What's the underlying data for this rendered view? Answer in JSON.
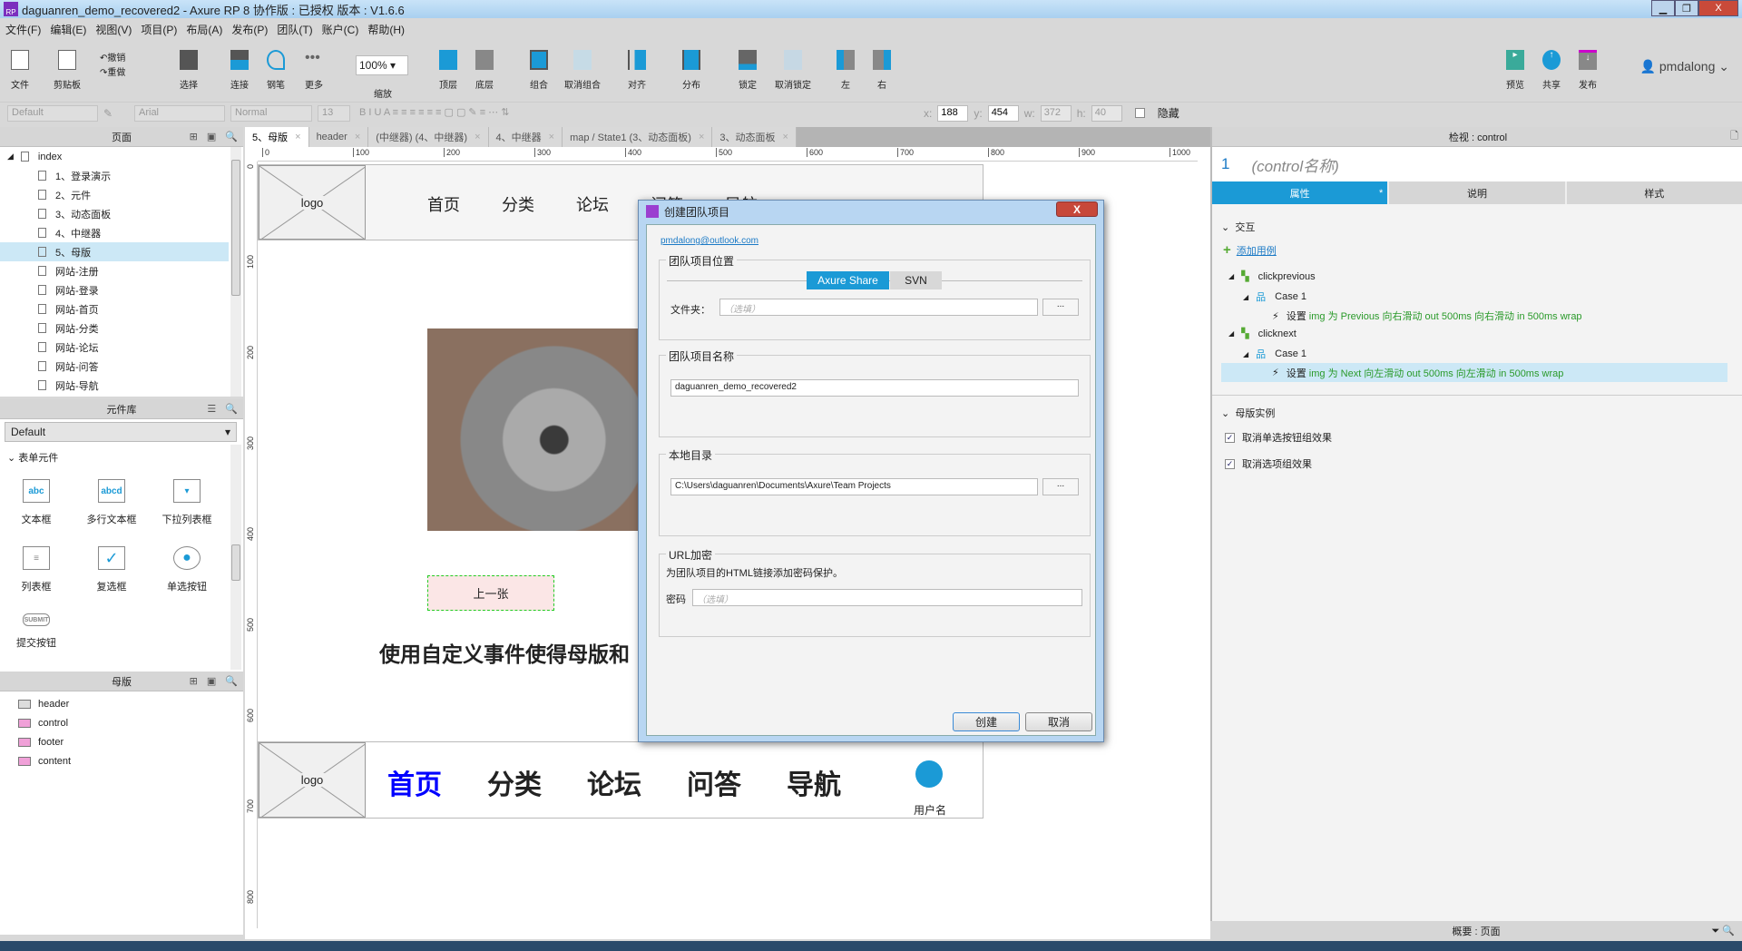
{
  "window": {
    "title": "daguanren_demo_recovered2 - Axure RP 8 协作版 : 已授权 版本 : V1.6.6",
    "app_icon": "RP"
  },
  "menu": [
    "文件(F)",
    "编辑(E)",
    "视图(V)",
    "项目(P)",
    "布局(A)",
    "发布(P)",
    "团队(T)",
    "账户(C)",
    "帮助(H)"
  ],
  "toolbar": {
    "file": "文件",
    "clipboard": "剪贴板",
    "undo": "撤销",
    "redo": "重做",
    "select": "选择",
    "connect": "连接",
    "pen": "钢笔",
    "more": "更多",
    "zoom_value": "100%",
    "zoom": "缩放",
    "top": "顶层",
    "bottom": "底层",
    "group": "组合",
    "ungroup": "取消组合",
    "align": "对齐",
    "distribute": "分布",
    "lock": "锁定",
    "unlock": "取消锁定",
    "left": "左",
    "right": "右",
    "preview": "预览",
    "share": "共享",
    "publish": "发布",
    "user": "pmdalong",
    "accent": "#1b9ad6"
  },
  "format": {
    "style": "Default",
    "font": "Arial",
    "weight": "Normal",
    "size": "13",
    "x_label": "x:",
    "x": "188",
    "y_label": "y:",
    "y": "454",
    "w_label": "w:",
    "w": "372",
    "h_label": "h:",
    "h": "40",
    "hidden": "隐藏"
  },
  "pages": {
    "title": "页面",
    "root": "index",
    "items": [
      "1、登录演示",
      "2、元件",
      "3、动态面板",
      "4、中继器",
      "5、母版",
      "网站-注册",
      "网站-登录",
      "网站-首页",
      "网站-分类",
      "网站-论坛",
      "网站-问答",
      "网站-导航"
    ],
    "selected": "5、母版"
  },
  "library": {
    "title": "元件库",
    "selected": "Default",
    "group": "表单元件",
    "widgets": [
      "文本框",
      "多行文本框",
      "下拉列表框",
      "列表框",
      "复选框",
      "单选按钮",
      "提交按钮"
    ]
  },
  "masters": {
    "title": "母版",
    "items": [
      "header",
      "control",
      "footer",
      "content"
    ]
  },
  "tabs": [
    "5、母版",
    "header",
    "(中继器) (4、中继器)",
    "4、中继器",
    "map / State1 (3、动态面板)",
    "3、动态面板"
  ],
  "ruler": {
    "h": [
      "0",
      "100",
      "200",
      "300",
      "400",
      "500",
      "600",
      "700",
      "800",
      "900",
      "1000"
    ],
    "v": [
      "0",
      "100",
      "200",
      "300",
      "400",
      "500",
      "600",
      "700",
      "800"
    ]
  },
  "canvas": {
    "logo": "logo",
    "nav_top": [
      "首页",
      "分类",
      "论坛",
      "问答",
      "导航"
    ],
    "prev_button": "上一张",
    "heading": "使用自定义事件使得母版和",
    "nav_bottom": [
      "首页",
      "分类",
      "论坛",
      "问答",
      "导航"
    ],
    "username": "用户名",
    "active_color": "#0000ff"
  },
  "dialog": {
    "title": "创建团队项目",
    "account": "pmdalong@outlook.com",
    "location_legend": "团队项目位置",
    "tab_share": "Axure Share",
    "tab_svn": "SVN",
    "folder_label": "文件夹：",
    "folder_placeholder": "（选填）",
    "browse": "...",
    "name_legend": "团队项目名称",
    "name_value": "daguanren_demo_recovered2",
    "local_legend": "本地目录",
    "local_value": "C:\\Users\\daguanren\\Documents\\Axure\\Team Projects",
    "url_legend": "URL加密",
    "url_desc": "为团队项目的HTML链接添加密码保护。",
    "password_label": "密码",
    "password_placeholder": "（选填）",
    "create": "创建",
    "cancel": "取消",
    "close": "X"
  },
  "inspector": {
    "title": "检视 : control",
    "index": "1",
    "name_placeholder": "(control名称)",
    "tabs": [
      "属性",
      "说明",
      "样式"
    ],
    "tab_marker": "*",
    "interactions": "交互",
    "add_case": "添加用例",
    "events": [
      {
        "name": "clickprevious",
        "case": "Case 1",
        "action_prefix": "设置",
        "action": "img 为 Previous 向右滑动 out 500ms 向右滑动 in 500ms wrap"
      },
      {
        "name": "clicknext",
        "case": "Case 1",
        "action_prefix": "设置",
        "action": "img 为 Next 向左滑动 out 500ms 向左滑动 in 500ms wrap"
      }
    ],
    "master_instance": "母版实例",
    "options": [
      {
        "label": "取消单选按钮组效果",
        "checked": true
      },
      {
        "label": "取消选项组效果",
        "checked": true
      }
    ]
  },
  "bottom": {
    "outline": "概要 : 页面"
  }
}
